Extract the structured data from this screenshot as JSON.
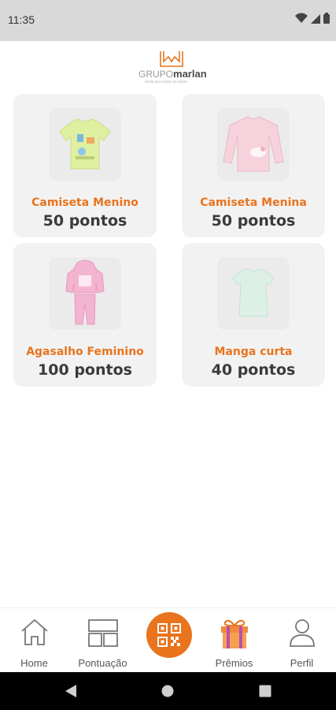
{
  "status": {
    "time": "11:35"
  },
  "brand": {
    "name_light": "GRUPO",
    "name_bold": "marlan",
    "tagline": "moda para todas as idades"
  },
  "products": [
    {
      "name": "Camiseta Menino",
      "points": "50 pontos",
      "icon": "yellow-tshirt-image"
    },
    {
      "name": "Camiseta Menina",
      "points": "50 pontos",
      "icon": "pink-longsleeve-image"
    },
    {
      "name": "Agasalho Feminino",
      "points": "100 pontos",
      "icon": "pink-tracksuit-image"
    },
    {
      "name": "Manga curta",
      "points": "40 pontos",
      "icon": "mint-tshirt-image"
    }
  ],
  "nav": {
    "home": "Home",
    "pontuacao": "Pontuação",
    "premios": "Prêmios",
    "perfil": "Perfil"
  },
  "colors": {
    "accent": "#e8741e",
    "card_bg": "#f2f2f2"
  }
}
